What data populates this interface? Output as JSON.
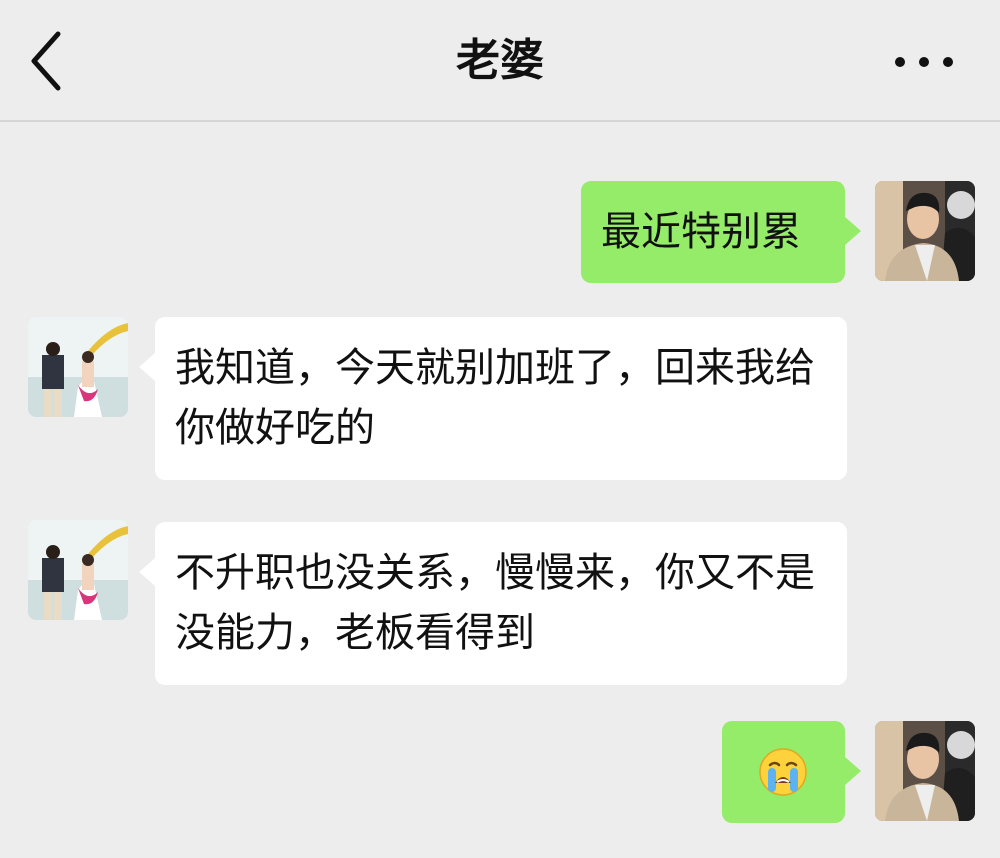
{
  "header": {
    "title": "老婆"
  },
  "icons": {
    "back": "chevron-left-icon",
    "more": "more-dots-icon",
    "emoji": "loudly-crying-face-emoji"
  },
  "colors": {
    "background": "#ededed",
    "sent_bubble": "#95ec69",
    "received_bubble": "#ffffff"
  },
  "messages": [
    {
      "side": "right",
      "text": "最近特别累"
    },
    {
      "side": "left",
      "text": "我知道，今天就别加班了，回来我给你做好吃的"
    },
    {
      "side": "left",
      "text": "不升职也没关系，慢慢来，你又不是没能力，老板看得到"
    },
    {
      "side": "right",
      "emoji": "😭"
    }
  ]
}
